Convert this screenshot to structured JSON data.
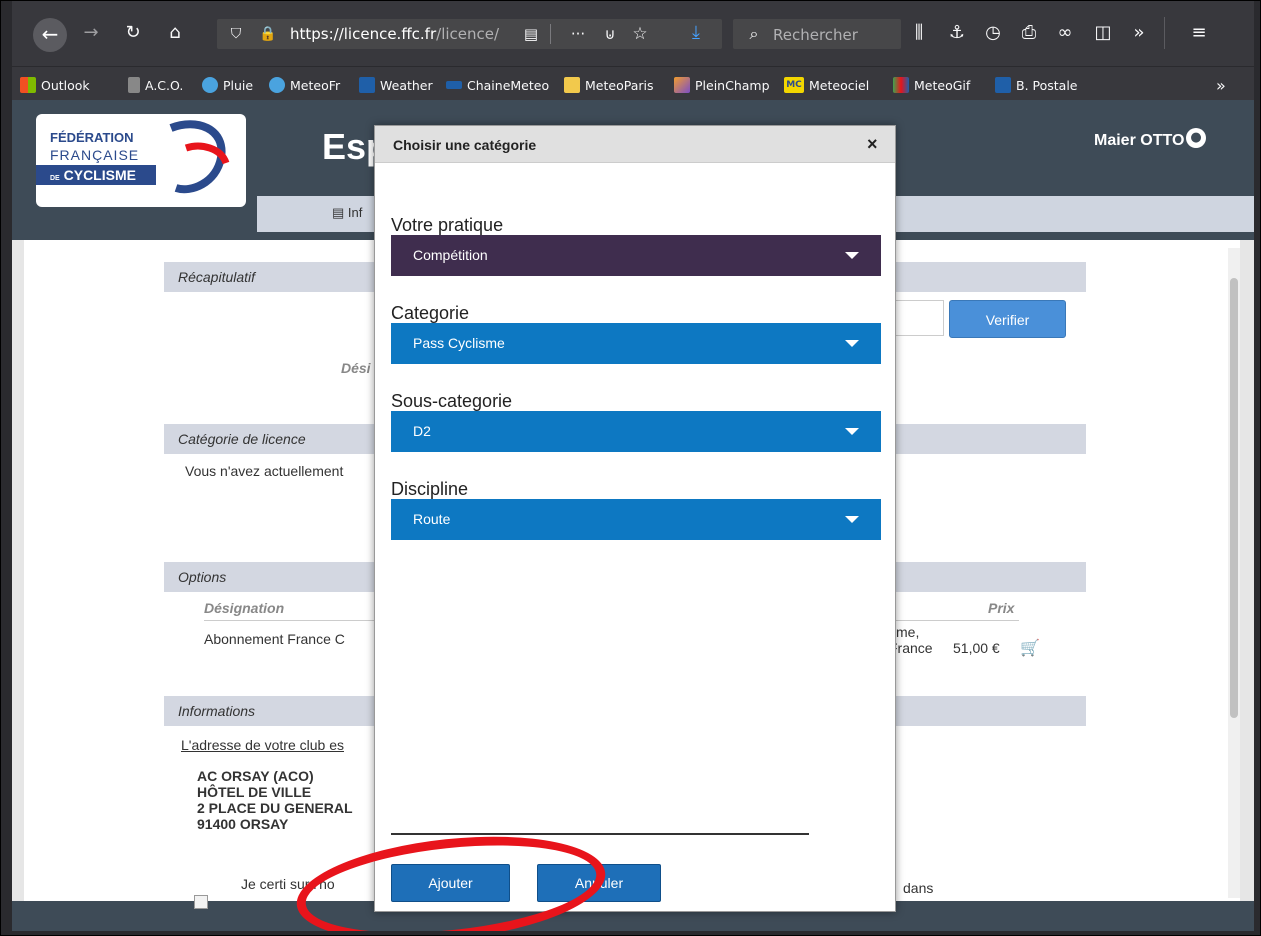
{
  "browser": {
    "url_host": "https://licence.ffc.fr",
    "url_path": "/licence/",
    "search_placeholder": "Rechercher",
    "icons": [
      "back-icon",
      "forward-icon",
      "reload-icon",
      "home-icon",
      "shield-icon",
      "lock-icon",
      "reader-icon",
      "more-icon",
      "pocket-icon",
      "star-icon",
      "download-icon",
      "search-icon",
      "library-icon",
      "sidebar-icon",
      "history-icon",
      "print-icon",
      "infinity-icon",
      "tab-icon",
      "overflow-icon",
      "hamburger-menu-icon"
    ]
  },
  "bookmarks": [
    {
      "label": "Outlook",
      "color": "#f25022"
    },
    {
      "label": "A.C.O.",
      "color": "#999999"
    },
    {
      "label": "Pluie",
      "color": "#4aa3df"
    },
    {
      "label": "MeteoFr",
      "color": "#4aa3df"
    },
    {
      "label": "Weather",
      "color": "#1f5fa8"
    },
    {
      "label": "ChaineMeteo",
      "color": "#1f5fa8"
    },
    {
      "label": "MeteoParis",
      "color": "#f2c94c"
    },
    {
      "label": "PleinChamp",
      "color": "#f29c2e"
    },
    {
      "label": "Meteociel",
      "color": "#f2d600"
    },
    {
      "label": "MeteoGif",
      "color": "#3fa34d"
    },
    {
      "label": "B. Postale",
      "color": "#1f5fa8"
    }
  ],
  "site": {
    "logo_line1": "FÉDÉRATION",
    "logo_line2": "FRANÇAISE",
    "logo_line3": "CYCLISME",
    "logo_prefix": "DE",
    "title": "Esp",
    "user": "Maier OTTO",
    "nav_label": "Inf"
  },
  "content": {
    "sections": {
      "recap": "Récapitulatif",
      "categorie": "Catégorie de licence",
      "options": "Options",
      "informations": "Informations"
    },
    "verify_label": "Verifier",
    "desig_partial": "Dési",
    "licence_text": "Vous n'avez actuellement",
    "options_head_designation": "Désignation",
    "options_head_prix": "Prix",
    "option_name": "Abonnement France C",
    "option_desc1": "sme,",
    "option_desc2": "France",
    "option_price": "51,00 €",
    "club_link": "L'adresse de votre club es",
    "club_name": "AC ORSAY (ACO)",
    "club_l1": "HÔTEL DE VILLE",
    "club_l2": "2 PLACE DU GENERAL",
    "club_l3": "91400 ORSAY",
    "certify_text": "Je certi",
    "certify_rest": "sur l'ho",
    "certify_end": "dans"
  },
  "modal": {
    "title": "Choisir une catégorie",
    "close": "×",
    "fields": [
      {
        "label": "Votre pratique",
        "value": "Compétition",
        "color": "#3f2d4e"
      },
      {
        "label": "Categorie",
        "value": "Pass Cyclisme",
        "color": "#0d78c2"
      },
      {
        "label": "Sous-categorie",
        "value": "D2",
        "color": "#0d78c2"
      },
      {
        "label": "Discipline",
        "value": "Route",
        "color": "#0d78c2"
      }
    ],
    "add_label": "Ajouter",
    "cancel_label": "Annuler"
  }
}
